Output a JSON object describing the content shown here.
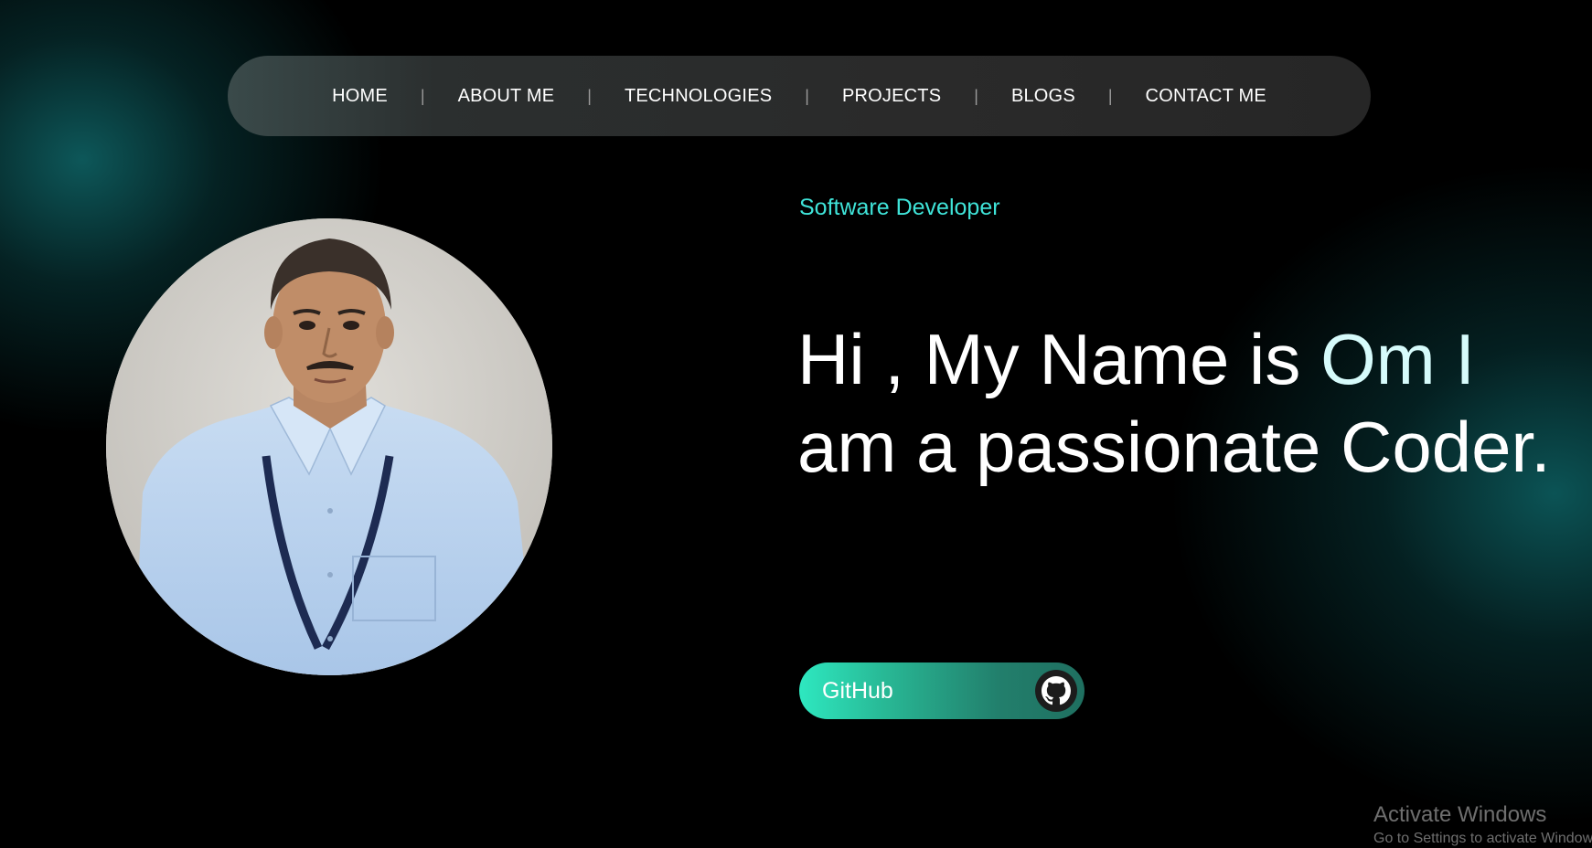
{
  "nav": {
    "items": [
      {
        "label": "HOME"
      },
      {
        "label": "ABOUT ME"
      },
      {
        "label": "TECHNOLOGIES"
      },
      {
        "label": "PROJECTS"
      },
      {
        "label": "BLOGS"
      },
      {
        "label": "CONTACT ME"
      }
    ],
    "separator": "|"
  },
  "hero": {
    "role": "Software Developer",
    "headline_part1": "Hi , My Name is ",
    "headline_name": "Om I",
    "headline_part2": "am a passionate Coder.",
    "button_label": "GitHub",
    "button_icon": "github-icon"
  },
  "watermark": {
    "title": "Activate Windows",
    "subtitle": "Go to Settings to activate Windows."
  },
  "colors": {
    "accent": "#3fe3d8",
    "background": "#000000",
    "nav_bg": "#2a2a2a",
    "button_gradient_start": "#2ee8c0",
    "button_gradient_end": "#1f6f60"
  }
}
